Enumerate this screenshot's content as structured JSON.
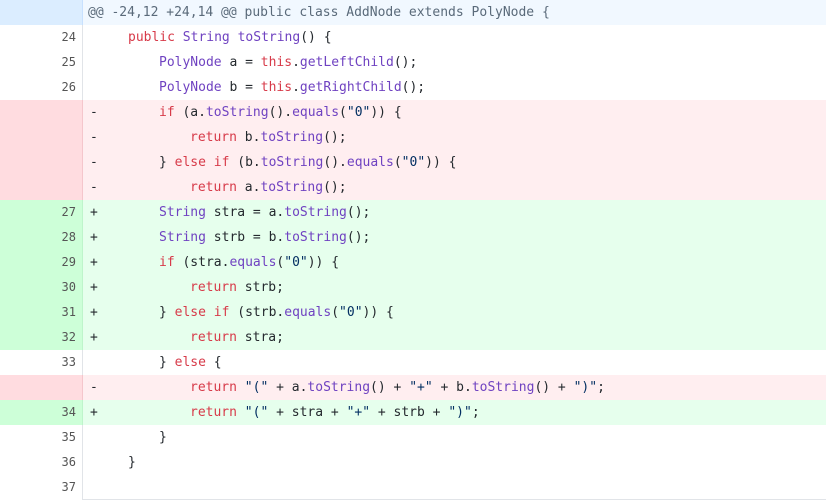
{
  "hunk_header": "@@ -24,12 +24,14 @@ public class AddNode extends PolyNode {",
  "lines": [
    {
      "type": "ctx",
      "num": "24",
      "sign": "",
      "indent": 1,
      "tokens": [
        [
          "kw",
          "public "
        ],
        [
          "ty",
          "String "
        ],
        [
          "fn",
          "toString"
        ],
        [
          "",
          "() {"
        ]
      ]
    },
    {
      "type": "ctx",
      "num": "25",
      "sign": "",
      "indent": 2,
      "tokens": [
        [
          "ty",
          "PolyNode "
        ],
        [
          "",
          "a = "
        ],
        [
          "kw",
          "this"
        ],
        [
          "",
          "."
        ],
        [
          "fn",
          "getLeftChild"
        ],
        [
          "",
          "();"
        ]
      ]
    },
    {
      "type": "ctx",
      "num": "26",
      "sign": "",
      "indent": 2,
      "tokens": [
        [
          "ty",
          "PolyNode "
        ],
        [
          "",
          "b = "
        ],
        [
          "kw",
          "this"
        ],
        [
          "",
          "."
        ],
        [
          "fn",
          "getRightChild"
        ],
        [
          "",
          "();"
        ]
      ]
    },
    {
      "type": "del",
      "num": "",
      "sign": "-",
      "indent": 2,
      "tokens": [
        [
          "kw",
          "if "
        ],
        [
          "",
          "(a."
        ],
        [
          "fn",
          "toString"
        ],
        [
          "",
          "()."
        ],
        [
          "fn",
          "equals"
        ],
        [
          "",
          "("
        ],
        [
          "st",
          "\"0\""
        ],
        [
          "",
          ")) {"
        ]
      ]
    },
    {
      "type": "del",
      "num": "",
      "sign": "-",
      "indent": 3,
      "tokens": [
        [
          "kw",
          "return "
        ],
        [
          "",
          "b."
        ],
        [
          "fn",
          "toString"
        ],
        [
          "",
          "();"
        ]
      ]
    },
    {
      "type": "del",
      "num": "",
      "sign": "-",
      "indent": 2,
      "tokens": [
        [
          "",
          "} "
        ],
        [
          "kw",
          "else if "
        ],
        [
          "",
          "(b."
        ],
        [
          "fn",
          "toString"
        ],
        [
          "",
          "()."
        ],
        [
          "fn",
          "equals"
        ],
        [
          "",
          "("
        ],
        [
          "st",
          "\"0\""
        ],
        [
          "",
          ")) {"
        ]
      ]
    },
    {
      "type": "del",
      "num": "",
      "sign": "-",
      "indent": 3,
      "tokens": [
        [
          "kw",
          "return "
        ],
        [
          "",
          "a."
        ],
        [
          "fn",
          "toString"
        ],
        [
          "",
          "();"
        ]
      ]
    },
    {
      "type": "add",
      "num": "27",
      "sign": "+",
      "indent": 2,
      "tokens": [
        [
          "ty",
          "String "
        ],
        [
          "",
          "stra = a."
        ],
        [
          "fn",
          "toString"
        ],
        [
          "",
          "();"
        ]
      ]
    },
    {
      "type": "add",
      "num": "28",
      "sign": "+",
      "indent": 2,
      "tokens": [
        [
          "ty",
          "String "
        ],
        [
          "",
          "strb = b."
        ],
        [
          "fn",
          "toString"
        ],
        [
          "",
          "();"
        ]
      ]
    },
    {
      "type": "add",
      "num": "29",
      "sign": "+",
      "indent": 2,
      "tokens": [
        [
          "kw",
          "if "
        ],
        [
          "",
          "(stra."
        ],
        [
          "fn",
          "equals"
        ],
        [
          "",
          "("
        ],
        [
          "st",
          "\"0\""
        ],
        [
          "",
          ")) {"
        ]
      ]
    },
    {
      "type": "add",
      "num": "30",
      "sign": "+",
      "indent": 3,
      "tokens": [
        [
          "kw",
          "return "
        ],
        [
          "",
          "strb;"
        ]
      ]
    },
    {
      "type": "add",
      "num": "31",
      "sign": "+",
      "indent": 2,
      "tokens": [
        [
          "",
          "} "
        ],
        [
          "kw",
          "else if "
        ],
        [
          "",
          "(strb."
        ],
        [
          "fn",
          "equals"
        ],
        [
          "",
          "("
        ],
        [
          "st",
          "\"0\""
        ],
        [
          "",
          ")) {"
        ]
      ]
    },
    {
      "type": "add",
      "num": "32",
      "sign": "+",
      "indent": 3,
      "tokens": [
        [
          "kw",
          "return "
        ],
        [
          "",
          "stra;"
        ]
      ]
    },
    {
      "type": "ctx",
      "num": "33",
      "sign": "",
      "indent": 2,
      "tokens": [
        [
          "",
          "} "
        ],
        [
          "kw",
          "else "
        ],
        [
          "",
          "{"
        ]
      ]
    },
    {
      "type": "del",
      "num": "",
      "sign": "-",
      "indent": 3,
      "tokens": [
        [
          "kw",
          "return "
        ],
        [
          "st",
          "\"(\""
        ],
        [
          "",
          " + a."
        ],
        [
          "fn",
          "toString"
        ],
        [
          "",
          "() + "
        ],
        [
          "st",
          "\"+\""
        ],
        [
          "",
          " + b."
        ],
        [
          "fn",
          "toString"
        ],
        [
          "",
          "() + "
        ],
        [
          "st",
          "\")\""
        ],
        [
          "",
          ";"
        ]
      ]
    },
    {
      "type": "add",
      "num": "34",
      "sign": "+",
      "indent": 3,
      "tokens": [
        [
          "kw",
          "return "
        ],
        [
          "st",
          "\"(\""
        ],
        [
          "",
          " + stra + "
        ],
        [
          "st",
          "\"+\""
        ],
        [
          "",
          " + strb + "
        ],
        [
          "st",
          "\")\""
        ],
        [
          "",
          ";"
        ]
      ]
    },
    {
      "type": "ctx",
      "num": "35",
      "sign": "",
      "indent": 2,
      "tokens": [
        [
          "",
          "}"
        ]
      ]
    },
    {
      "type": "ctx",
      "num": "36",
      "sign": "",
      "indent": 1,
      "tokens": [
        [
          "",
          "}"
        ]
      ]
    },
    {
      "type": "ctx",
      "num": "37",
      "sign": "",
      "indent": 0,
      "tokens": [
        [
          "",
          ""
        ]
      ]
    }
  ],
  "colors": {
    "hunk_bg": "#f1f8ff",
    "deleted_bg": "#ffeef0",
    "deleted_gutter": "#ffdce0",
    "added_bg": "#e6ffed",
    "added_gutter": "#cdffd8",
    "keyword": "#d73a49",
    "type": "#6f42c1",
    "string": "#032f62"
  }
}
